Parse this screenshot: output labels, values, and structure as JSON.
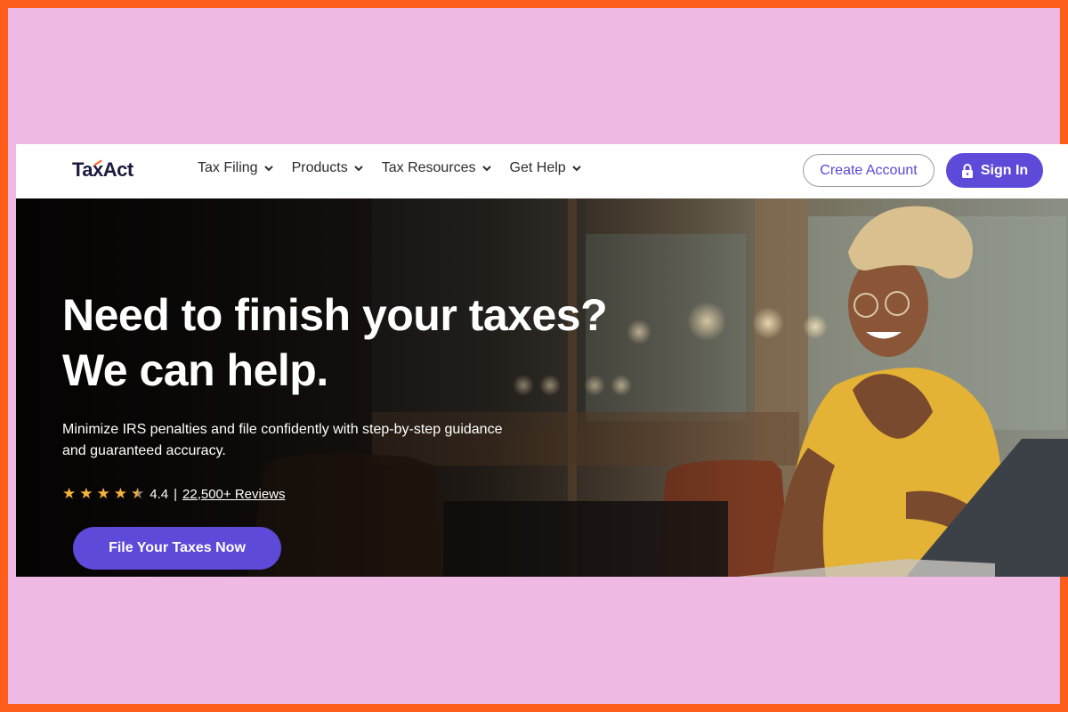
{
  "brand": {
    "logo_text_pre": "Ta",
    "logo_text_x": "x",
    "logo_text_post": "Act"
  },
  "nav": {
    "items": [
      {
        "label": "Tax Filing"
      },
      {
        "label": "Products"
      },
      {
        "label": "Tax Resources"
      },
      {
        "label": "Get Help"
      }
    ]
  },
  "header": {
    "create_account": "Create Account",
    "sign_in": "Sign In"
  },
  "hero": {
    "headline_line1": "Need to finish your taxes?",
    "headline_line2": "We can help.",
    "subtext_line1": "Minimize IRS penalties and file confidently with step-by-step guidance",
    "subtext_line2": "and guaranteed accuracy.",
    "rating_value": "4.4",
    "rating_stars": 4.4,
    "separator": "|",
    "reviews_link": "22,500+ Reviews",
    "cta": "File Your Taxes Now"
  },
  "colors": {
    "frame_border": "#ff5e1a",
    "frame_bg": "#f0b9e3",
    "brand_purple": "#5e4ad8",
    "star": "#f6b23c",
    "logo": "#1d1a3f"
  },
  "icons": {
    "nav_dropdown": "chevron-down-icon",
    "sign_in": "lock-icon",
    "rating": "star-icon"
  }
}
